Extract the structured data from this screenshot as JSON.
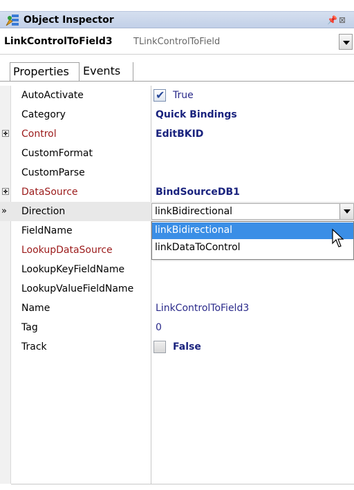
{
  "window": {
    "title": "Object Inspector",
    "pin_icon": "pin-icon",
    "close_icon": "close-icon",
    "app_icon": "object-inspector-icon"
  },
  "selector": {
    "object_name": "LinkControlToField3",
    "object_type": "TLinkControlToField"
  },
  "tabs": [
    {
      "label": "Properties",
      "active": true
    },
    {
      "label": "Events",
      "active": false
    }
  ],
  "properties": [
    {
      "name": "AutoActivate",
      "value": "True"
    },
    {
      "name": "Category",
      "value": "Quick Bindings"
    },
    {
      "name": "Control",
      "value": "EditBKID"
    },
    {
      "name": "CustomFormat",
      "value": ""
    },
    {
      "name": "CustomParse",
      "value": ""
    },
    {
      "name": "DataSource",
      "value": "BindSourceDB1"
    },
    {
      "name": "Direction",
      "value": "linkBidirectional"
    },
    {
      "name": "FieldName",
      "value": ""
    },
    {
      "name": "LookupDataSource",
      "value": ""
    },
    {
      "name": "LookupKeyFieldName",
      "value": ""
    },
    {
      "name": "LookupValueFieldName",
      "value": ""
    },
    {
      "name": "Name",
      "value": "LinkControlToField3"
    },
    {
      "name": "Tag",
      "value": "0"
    },
    {
      "name": "Track",
      "value": "False"
    }
  ],
  "current_marker": "»",
  "dropdown": {
    "options": [
      "linkBidirectional",
      "linkDataToControl"
    ],
    "highlighted": "linkBidirectional"
  },
  "colors": {
    "link_property": "#9b1a1a",
    "bold_value": "#1a237e",
    "highlight": "#3a8ee6"
  }
}
